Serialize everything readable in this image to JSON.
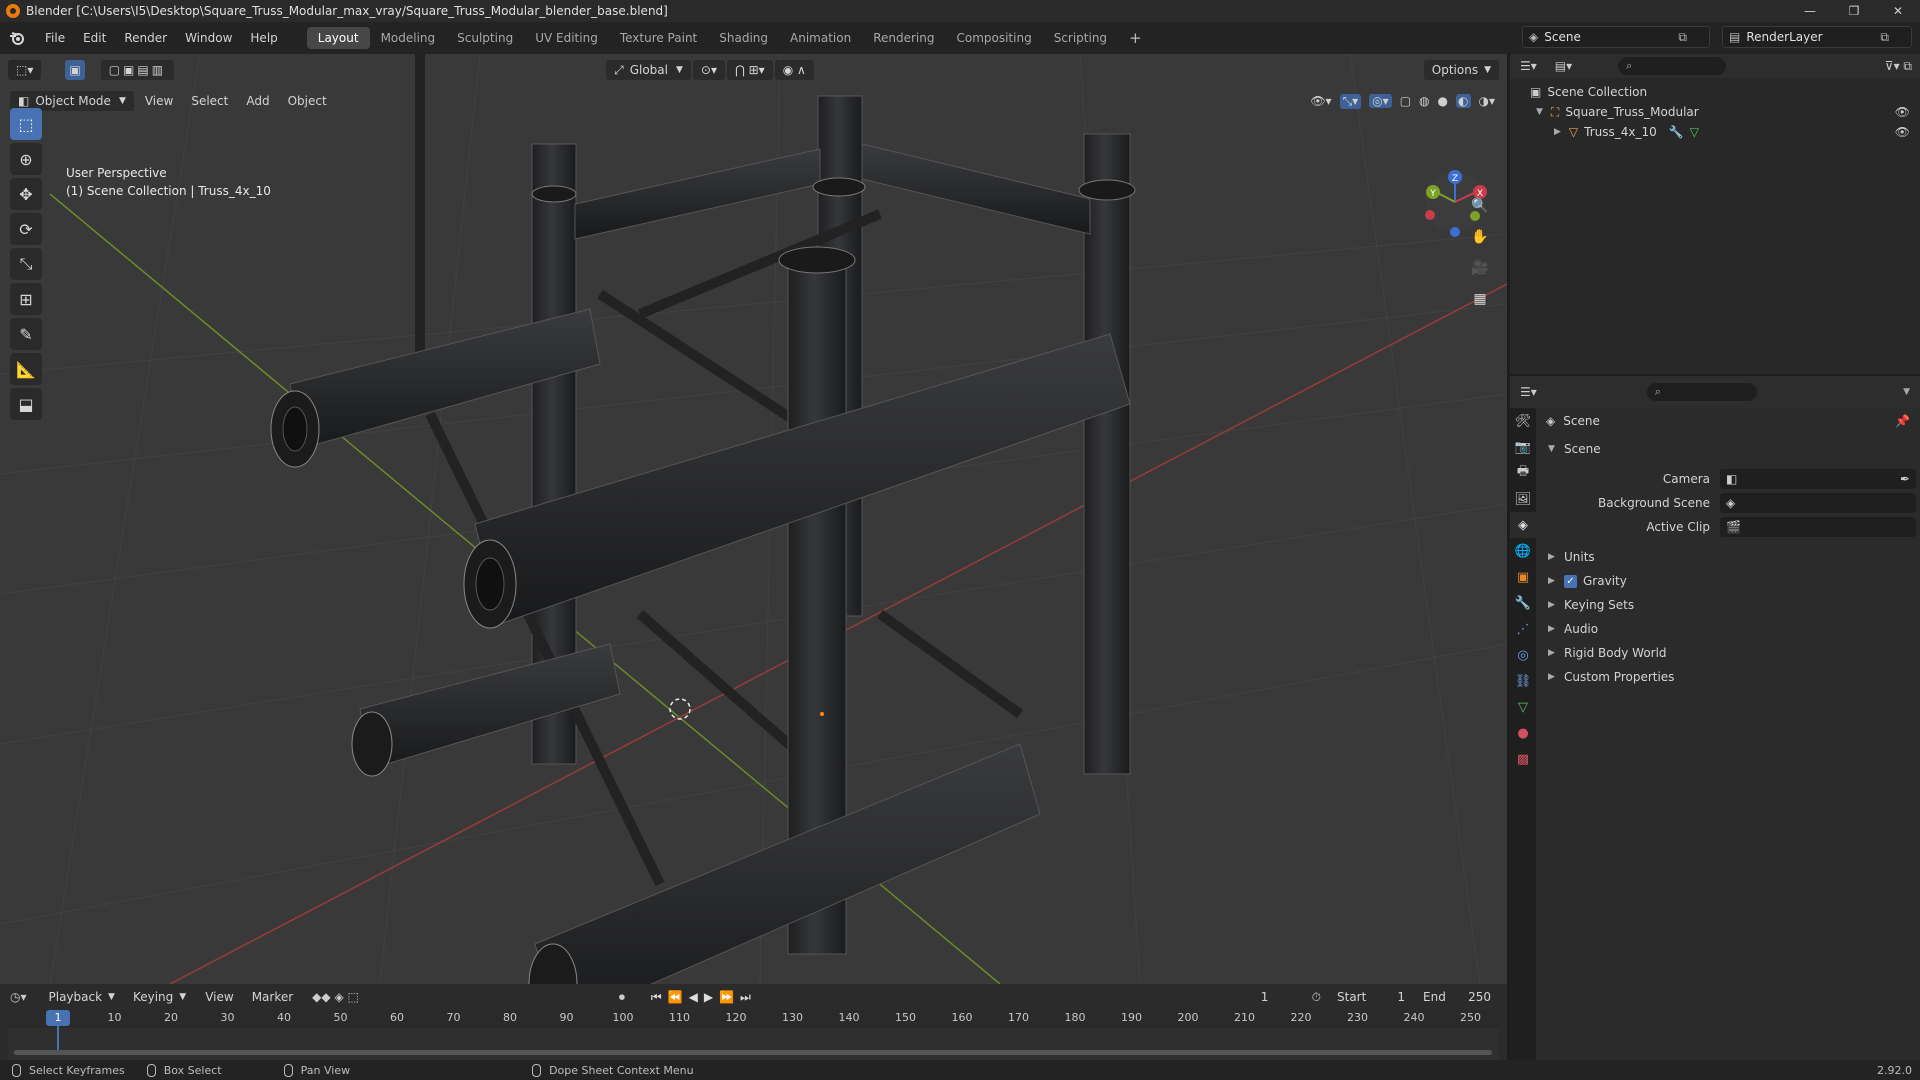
{
  "window": {
    "title": "Blender [C:\\Users\\I5\\Desktop\\Square_Truss_Modular_max_vray/Square_Truss_Modular_blender_base.blend]",
    "controls": [
      "—",
      "❐",
      "✕"
    ]
  },
  "menu": {
    "items": [
      "File",
      "Edit",
      "Render",
      "Window",
      "Help"
    ]
  },
  "workspaces": {
    "tabs": [
      "Layout",
      "Modeling",
      "Sculpting",
      "UV Editing",
      "Texture Paint",
      "Shading",
      "Animation",
      "Rendering",
      "Compositing",
      "Scripting"
    ],
    "active": "Layout",
    "add": "+"
  },
  "scene_selector": {
    "scene": "Scene",
    "view_layer": "RenderLayer"
  },
  "viewport": {
    "mode": "Object Mode",
    "menus": [
      "View",
      "Select",
      "Add",
      "Object"
    ],
    "orientation": "Global",
    "options": "Options",
    "overlay_line1": "User Perspective",
    "overlay_line2": "(1) Scene Collection | Truss_4x_10",
    "gizmo": {
      "x": "X",
      "y": "Y",
      "z": "Z"
    },
    "colors": {
      "bg": "#393939",
      "grid": "#444444",
      "axis_x": "#9a3b3b",
      "axis_y": "#6a8a2a",
      "truss": "#2b2c2e"
    }
  },
  "outliner": {
    "root": "Scene Collection",
    "items": [
      {
        "name": "Square_Truss_Modular",
        "type": "collection"
      },
      {
        "name": "Truss_4x_10",
        "type": "mesh"
      }
    ]
  },
  "properties": {
    "context": "Scene",
    "panel": "Scene",
    "fields": [
      {
        "label": "Camera",
        "value": ""
      },
      {
        "label": "Background Scene",
        "value": ""
      },
      {
        "label": "Active Clip",
        "value": ""
      }
    ],
    "subpanels": [
      "Units",
      "Gravity",
      "Keying Sets",
      "Audio",
      "Rigid Body World",
      "Custom Properties"
    ],
    "gravity_checked": true
  },
  "timeline": {
    "menus": [
      "Playback",
      "Keying",
      "View",
      "Marker"
    ],
    "current_frame": "1",
    "start_label": "Start",
    "start": "1",
    "end_label": "End",
    "end": "250",
    "ticks": [
      "1",
      "10",
      "20",
      "30",
      "40",
      "50",
      "60",
      "70",
      "80",
      "90",
      "100",
      "110",
      "120",
      "130",
      "140",
      "150",
      "160",
      "170",
      "180",
      "190",
      "200",
      "210",
      "220",
      "230",
      "240",
      "250"
    ]
  },
  "statusbar": {
    "items": [
      "Select Keyframes",
      "Box Select",
      "Pan View",
      "Dope Sheet Context Menu"
    ],
    "version": "2.92.0"
  }
}
